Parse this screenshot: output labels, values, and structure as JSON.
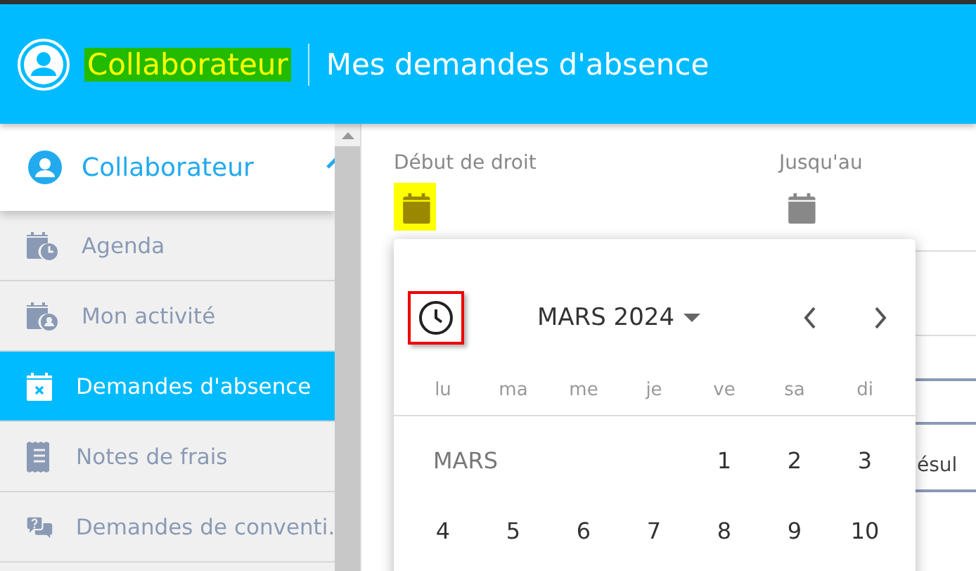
{
  "header": {
    "section": "Collaborateur",
    "section_highlighted": true,
    "title": "Mes demandes d'absence"
  },
  "sidebar": {
    "profile": {
      "label": "Collaborateur"
    },
    "items": [
      {
        "label": "Agenda",
        "selected": false
      },
      {
        "label": "Mon activité",
        "selected": false
      },
      {
        "label": "Demandes d'absence",
        "selected": true
      },
      {
        "label": "Notes de frais",
        "selected": false
      },
      {
        "label": "Demandes de conventi.",
        "selected": false
      }
    ]
  },
  "form": {
    "fields": [
      {
        "label": "Début de droit",
        "icon_highlighted": true
      },
      {
        "label": "Jusqu'au",
        "icon_highlighted": false
      }
    ],
    "behind_text": "ésul"
  },
  "datepicker": {
    "clock_outlined": true,
    "month": "MARS 2024",
    "weekdays": [
      "lu",
      "ma",
      "me",
      "je",
      "ve",
      "sa",
      "di"
    ],
    "month_label": "MARS",
    "weeks": [
      [
        "1",
        "2",
        "3"
      ],
      [
        "4",
        "5",
        "6",
        "7",
        "8",
        "9",
        "10"
      ]
    ]
  }
}
